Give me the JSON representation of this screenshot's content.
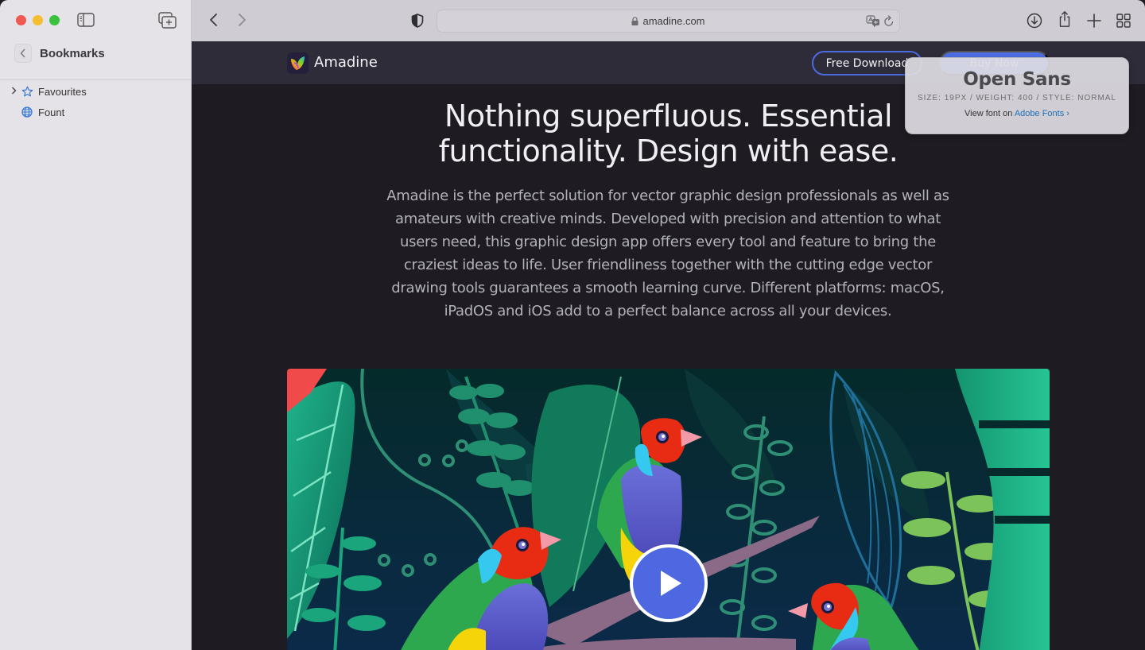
{
  "window": {
    "traffic_lights": [
      "close",
      "minimize",
      "maximize"
    ]
  },
  "sidebar": {
    "title": "Bookmarks",
    "items": [
      {
        "label": "Favourites",
        "icon": "star-icon",
        "expandable": true
      },
      {
        "label": "Fount",
        "icon": "globe-icon",
        "expandable": false
      }
    ]
  },
  "toolbar": {
    "url": "amadine.com",
    "icons": [
      "back-icon",
      "forward-icon",
      "privacy-shield-icon",
      "lock-icon",
      "translate-icon",
      "reload-icon",
      "download-icon",
      "share-icon",
      "new-tab-icon",
      "tab-overview-icon"
    ]
  },
  "site": {
    "brand": "Amadine",
    "free_download": "Free Download",
    "buy_now": "Buy Now",
    "headline_line1": "Nothing superfluous. Essential",
    "headline_line2": "functionality. Design with ease.",
    "paragraph": "Amadine is the perfect solution for vector graphic design professionals as well as amateurs with creative minds. Developed with precision and attention to what users need, this graphic design app offers every tool and feature to bring the craziest ideas to life. User friendliness together with the cutting edge vector drawing tools guarantees a smooth learning curve. Different platforms: macOS, iPadOS and iOS add to a perfect balance across all your devices.",
    "video_alt": "Jungle illustration with Gouldian finches"
  },
  "font_tooltip": {
    "font_name": "Open Sans",
    "meta": "SIZE: 19PX / WEIGHT: 400 / STYLE: NORMAL",
    "view_prefix": "View font on ",
    "view_link": "Adobe Fonts ›"
  },
  "colors": {
    "accent": "#4f6fe8",
    "page_bg": "#1e1c22",
    "nav_bg": "#2e2c39",
    "link": "#1f6fb8"
  }
}
